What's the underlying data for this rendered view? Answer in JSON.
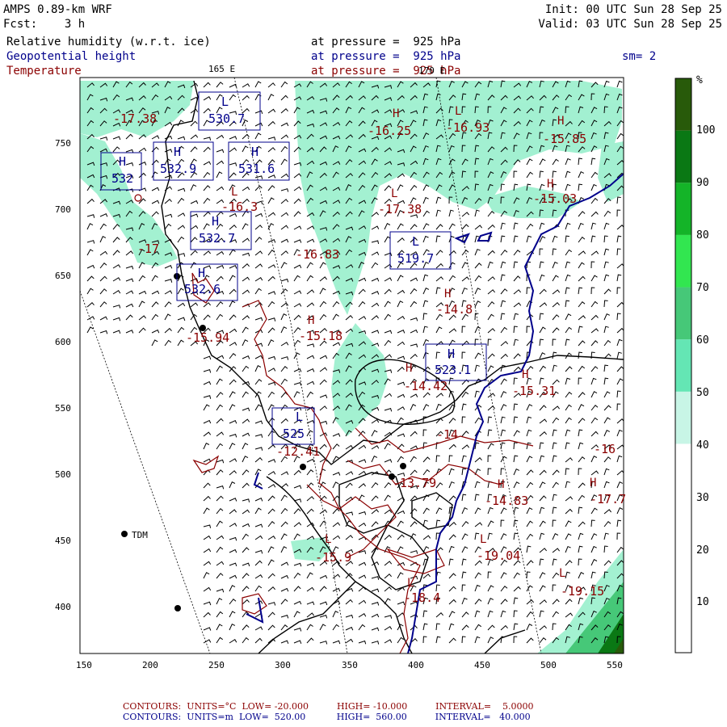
{
  "header": {
    "model": "AMPS 0.89-km WRF",
    "init": "Init: 00 UTC Sun 28 Sep 25",
    "fcst": "Fcst:    3 h",
    "valid": "Valid: 03 UTC Sun 28 Sep 25"
  },
  "variables": [
    {
      "name": "Relative humidity (w.r.t. ice)",
      "level": "at pressure =  925 hPa",
      "color": "#000000"
    },
    {
      "name": "Geopotential height",
      "level": "at pressure =  925 hPa",
      "color": "#00008b"
    },
    {
      "name": "Temperature",
      "level": "at pressure =  925 hPa",
      "color": "#8b0000"
    }
  ],
  "smoothing": "sm= 2",
  "lon_labels": [
    "165 E",
    "170 E"
  ],
  "axes": {
    "x_ticks": [
      "150",
      "200",
      "250",
      "300",
      "350",
      "400",
      "450",
      "500",
      "550"
    ],
    "y_ticks": [
      "750",
      "700",
      "650",
      "600",
      "550",
      "500",
      "450",
      "400"
    ]
  },
  "colorbar": {
    "unit": "%",
    "ticks": [
      "10",
      "20",
      "30",
      "40",
      "50",
      "60",
      "70",
      "80",
      "90",
      "100"
    ],
    "colors": [
      "#ffffff",
      "#ffffff",
      "#ffffff",
      "#c8f5e6",
      "#64e6b4",
      "#46c878",
      "#32e650",
      "#14b428",
      "#0a7814",
      "#285a0a"
    ]
  },
  "colors": {
    "height": "#00008b",
    "temperature": "#8b0000",
    "coast": "#000000",
    "rh": "#9ef0cf"
  },
  "height_labels": [
    {
      "t": "H",
      "v": "532"
    },
    {
      "t": "H",
      "v": "532.9"
    },
    {
      "t": "H",
      "v": "531.6"
    },
    {
      "t": "L",
      "v": "530.7"
    },
    {
      "t": "H",
      "v": "532.7"
    },
    {
      "t": "H",
      "v": "532.6"
    },
    {
      "t": "L",
      "v": "519.7"
    },
    {
      "t": "H",
      "v": "523.1"
    },
    {
      "t": "L",
      "v": "525"
    }
  ],
  "temp_labels": [
    {
      "t": "",
      "v": "-17.38"
    },
    {
      "t": "H",
      "v": "-16.25"
    },
    {
      "t": "L",
      "v": "-16.93"
    },
    {
      "t": "H",
      "v": "-15.85"
    },
    {
      "t": "H",
      "v": "-15.03"
    },
    {
      "t": "L",
      "v": "-17.38"
    },
    {
      "t": "L",
      "v": "-16.3"
    },
    {
      "t": "",
      "v": "-17"
    },
    {
      "t": "",
      "v": "-16.83"
    },
    {
      "t": "H",
      "v": "-14.8"
    },
    {
      "t": "H",
      "v": "-15.18"
    },
    {
      "t": "",
      "v": "-15.94"
    },
    {
      "t": "H",
      "v": "-14.42"
    },
    {
      "t": "H",
      "v": "-15.31"
    },
    {
      "t": "",
      "v": "-14"
    },
    {
      "t": "",
      "v": "-12.41"
    },
    {
      "t": "",
      "v": "-13.79"
    },
    {
      "t": "H",
      "v": "-14.83"
    },
    {
      "t": "",
      "v": "-16"
    },
    {
      "t": "H",
      "v": "-17.7"
    },
    {
      "t": "L",
      "v": "-15.9"
    },
    {
      "t": "L",
      "v": "-19.04"
    },
    {
      "t": "L",
      "v": "-18.4"
    },
    {
      "t": "L",
      "v": "-19.15"
    }
  ],
  "station": "TDM",
  "footer": {
    "temp": "CONTOURS:  UNITS=°C  LOW= -20.000          HIGH= -10.000          INTERVAL=    5.0000",
    "height": "CONTOURS:  UNITS=m  LOW=  520.00           HIGH=  560.00          INTERVAL=   40.000"
  }
}
